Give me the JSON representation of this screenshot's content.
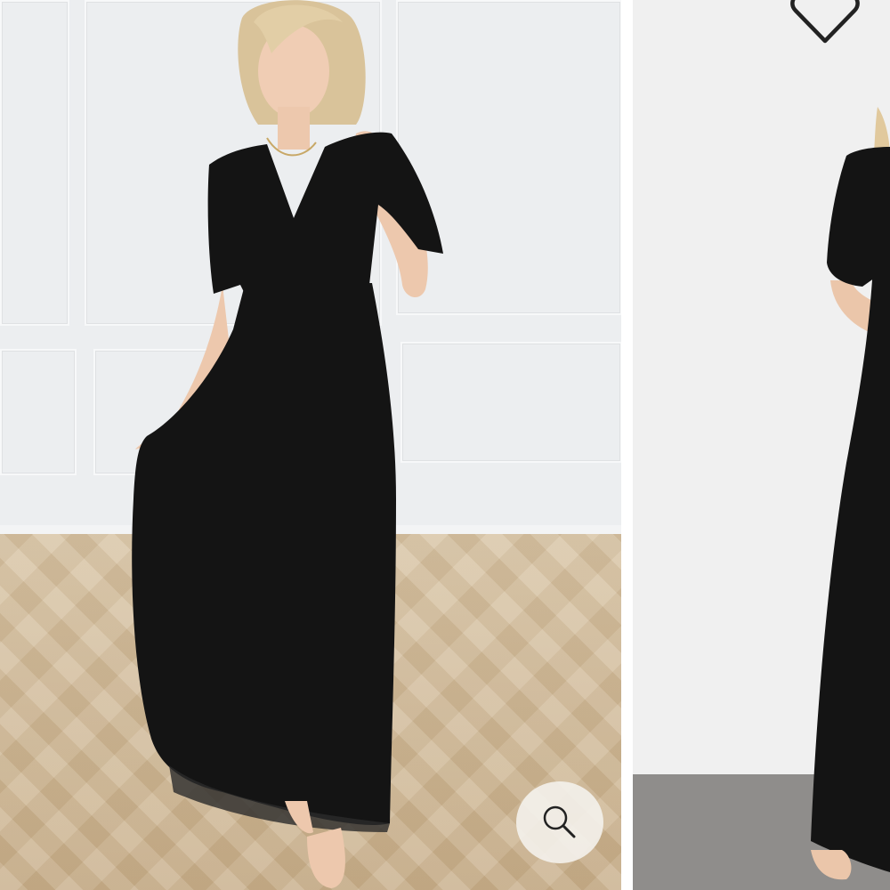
{
  "gallery": {
    "slides": [
      {
        "alt": "",
        "dress_color": "#141414"
      },
      {
        "alt": "",
        "dress_color": "#141414"
      }
    ],
    "zoom_icon": "magnifier-icon",
    "wishlist_icon": "heart-outline-icon"
  },
  "colors": {
    "dress": "#141414",
    "wall": "#eceef0",
    "floor": "#cdb593",
    "icon": "#222222"
  }
}
